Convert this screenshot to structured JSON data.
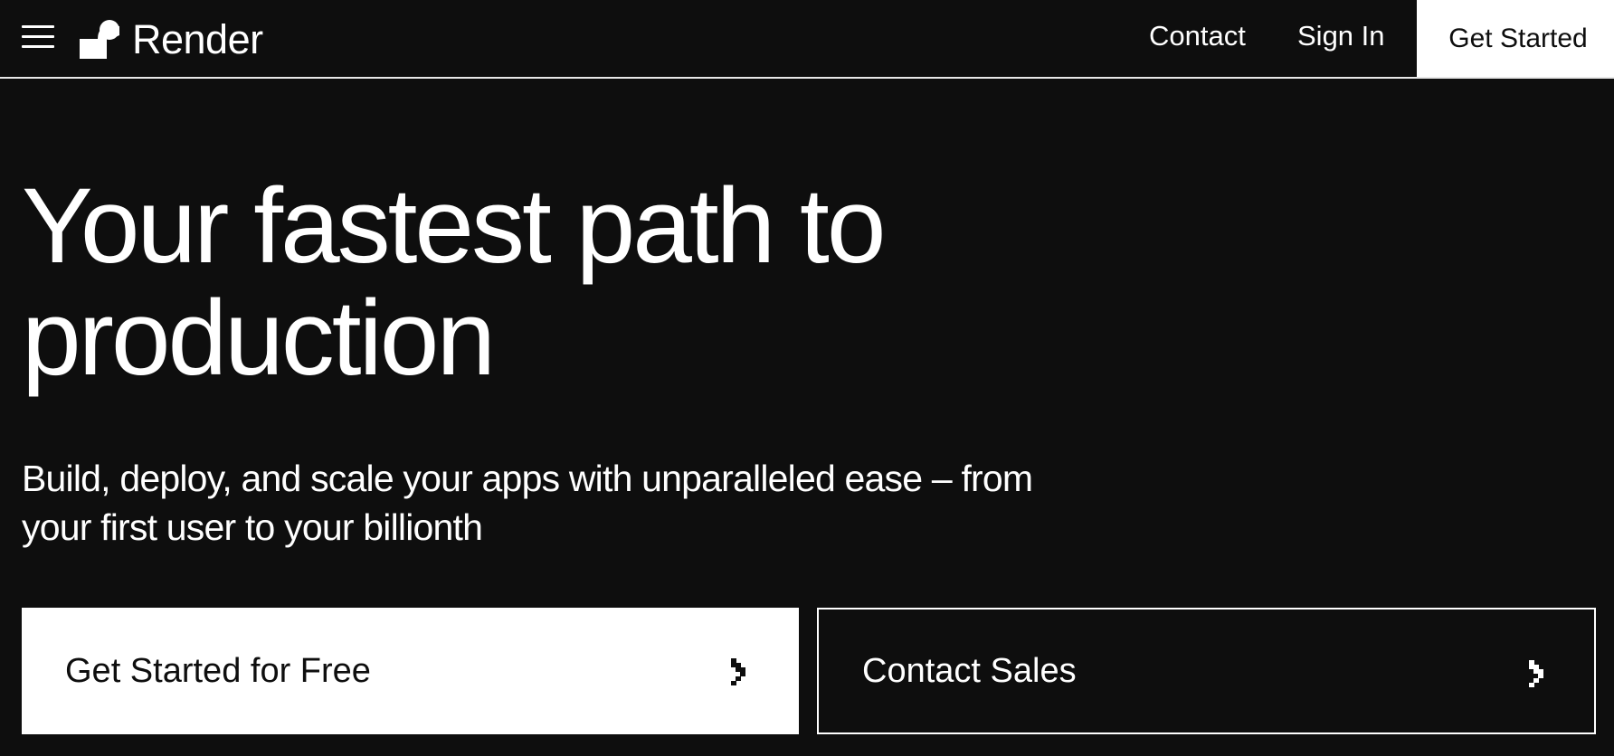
{
  "header": {
    "brand": "Render",
    "nav": {
      "contact": "Contact",
      "sign_in": "Sign In",
      "get_started": "Get Started"
    }
  },
  "hero": {
    "headline_line1": "Your fastest path to",
    "headline_line2": "production",
    "subhead_line1": "Build, deploy, and scale your apps with unparalleled ease – from",
    "subhead_line2": "your first user to your billionth",
    "primary_cta": "Get Started for Free",
    "secondary_cta": "Contact Sales"
  },
  "icons": {
    "menu": "hamburger-menu-icon",
    "logo": "render-logo-icon",
    "cta_arrow": "chevron-right-icon"
  },
  "colors": {
    "background": "#0e0e0e",
    "foreground": "#ffffff",
    "cta_text_dark": "#0e0e0e"
  }
}
